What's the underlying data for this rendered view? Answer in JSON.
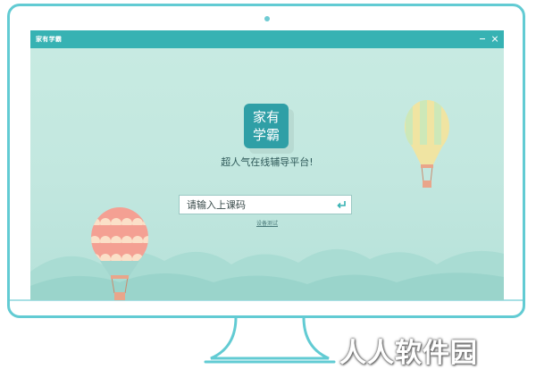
{
  "window": {
    "title": "家有学霸"
  },
  "logo": {
    "text": "家有学霸"
  },
  "main": {
    "slogan": "超人气在线辅导平台!",
    "code_placeholder": "请输入上课码",
    "device_test_label": "设备测试"
  },
  "watermark": {
    "text": "人人软件园"
  },
  "colors": {
    "accent": "#37b2b3",
    "background": "#c2e7df",
    "monitor_frame": "#62cbd3",
    "logo_tile": "#2f9fa6",
    "balloon_coral": "#f4a093",
    "balloon_yellow": "#f0e4a2"
  },
  "icons": {
    "enter": "enter-return-icon",
    "minimize": "minimize-icon",
    "close": "close-icon"
  }
}
